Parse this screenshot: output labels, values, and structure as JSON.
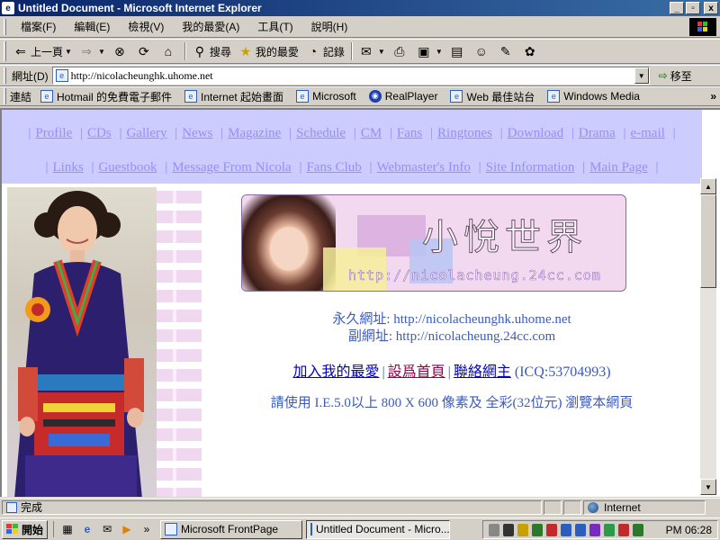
{
  "window": {
    "title": "Untitled Document - Microsoft Internet Explorer",
    "minimize": "_",
    "maximize": "▫",
    "close": "x"
  },
  "menubar": {
    "items": [
      "檔案(F)",
      "編輯(E)",
      "檢視(V)",
      "我的最愛(A)",
      "工具(T)",
      "說明(H)"
    ]
  },
  "toolbar": {
    "back": "上一頁",
    "search": "搜尋",
    "favorites": "我的最愛",
    "history": "記錄"
  },
  "address": {
    "label": "網址(D)",
    "url": "http://nicolacheunghk.uhome.net",
    "go": "移至"
  },
  "links": {
    "label": "連結",
    "items": [
      "Hotmail 的免費電子郵件",
      "Internet 起始畫面",
      "Microsoft",
      "RealPlayer",
      "Web 最佳站台",
      "Windows Media"
    ],
    "more": "»"
  },
  "nav": {
    "row1": [
      "Profile",
      "CDs",
      "Gallery",
      "News",
      "Magazine",
      "Schedule",
      "CM",
      "Fans",
      "Ringtones",
      "Download",
      "Drama",
      "e-mail"
    ],
    "row2": [
      "Links",
      "Guestbook",
      "Message From Nicola",
      "Fans Club",
      "Webmaster's Info",
      "Site Information",
      "Main Page"
    ]
  },
  "banner": {
    "brand": "小悅世界",
    "url": "http://nicolacheung.24cc.com"
  },
  "info": {
    "permanent": "永久網址: http://nicolacheunghk.uhome.net",
    "secondary": "副網址: http://nicolacheung.24cc.com",
    "add_favorite": "加入我的最愛",
    "set_home": "設爲首頁",
    "contact": "聯絡網主",
    "icq": "(ICQ:53704993)",
    "notice": "請使用 I.E.5.0以上 800 X 600 像素及 全彩(32位元) 瀏覽本網頁",
    "sep": "|"
  },
  "status": {
    "text": "完成",
    "zone": "Internet"
  },
  "taskbar": {
    "start": "開始",
    "tasks": [
      "Microsoft FrontPage",
      "Untitled Document - Micro..."
    ],
    "clock": "PM 06:28"
  }
}
